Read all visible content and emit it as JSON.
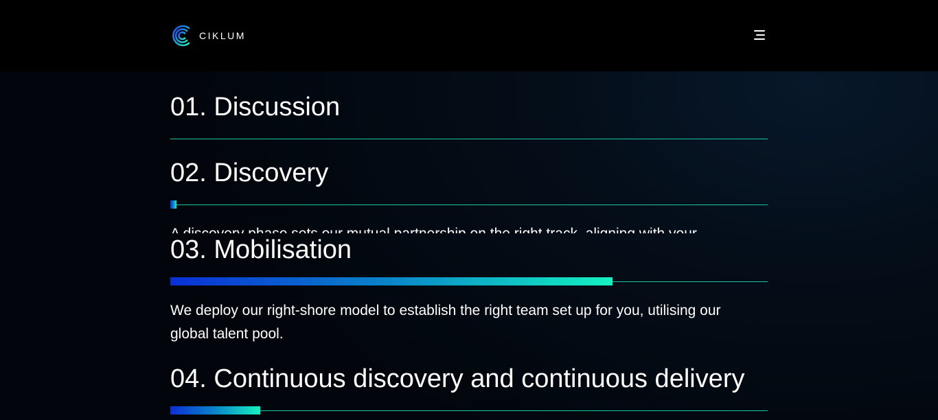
{
  "header": {
    "brand": "CIKLUM",
    "menu_icon": "hamburger-menu-icon"
  },
  "colors": {
    "accent": "#19c9a2",
    "gradient_start": "#0a2fd6",
    "gradient_end": "#14f2c0",
    "background": "#02060c"
  },
  "steps": [
    {
      "title": "01. Discussion",
      "progress": 0
    },
    {
      "title": "02. Discovery",
      "progress": 0.01,
      "description": "A discovery phase sets our mutual partnership on the right track, aligning with your"
    },
    {
      "title": "03. Mobilisation",
      "progress": 0.74,
      "description": "We deploy our right-shore model to establish the right team set up for you, utilising our global talent pool."
    },
    {
      "title": "04. Continuous discovery and continuous delivery",
      "progress": 0.15
    }
  ]
}
